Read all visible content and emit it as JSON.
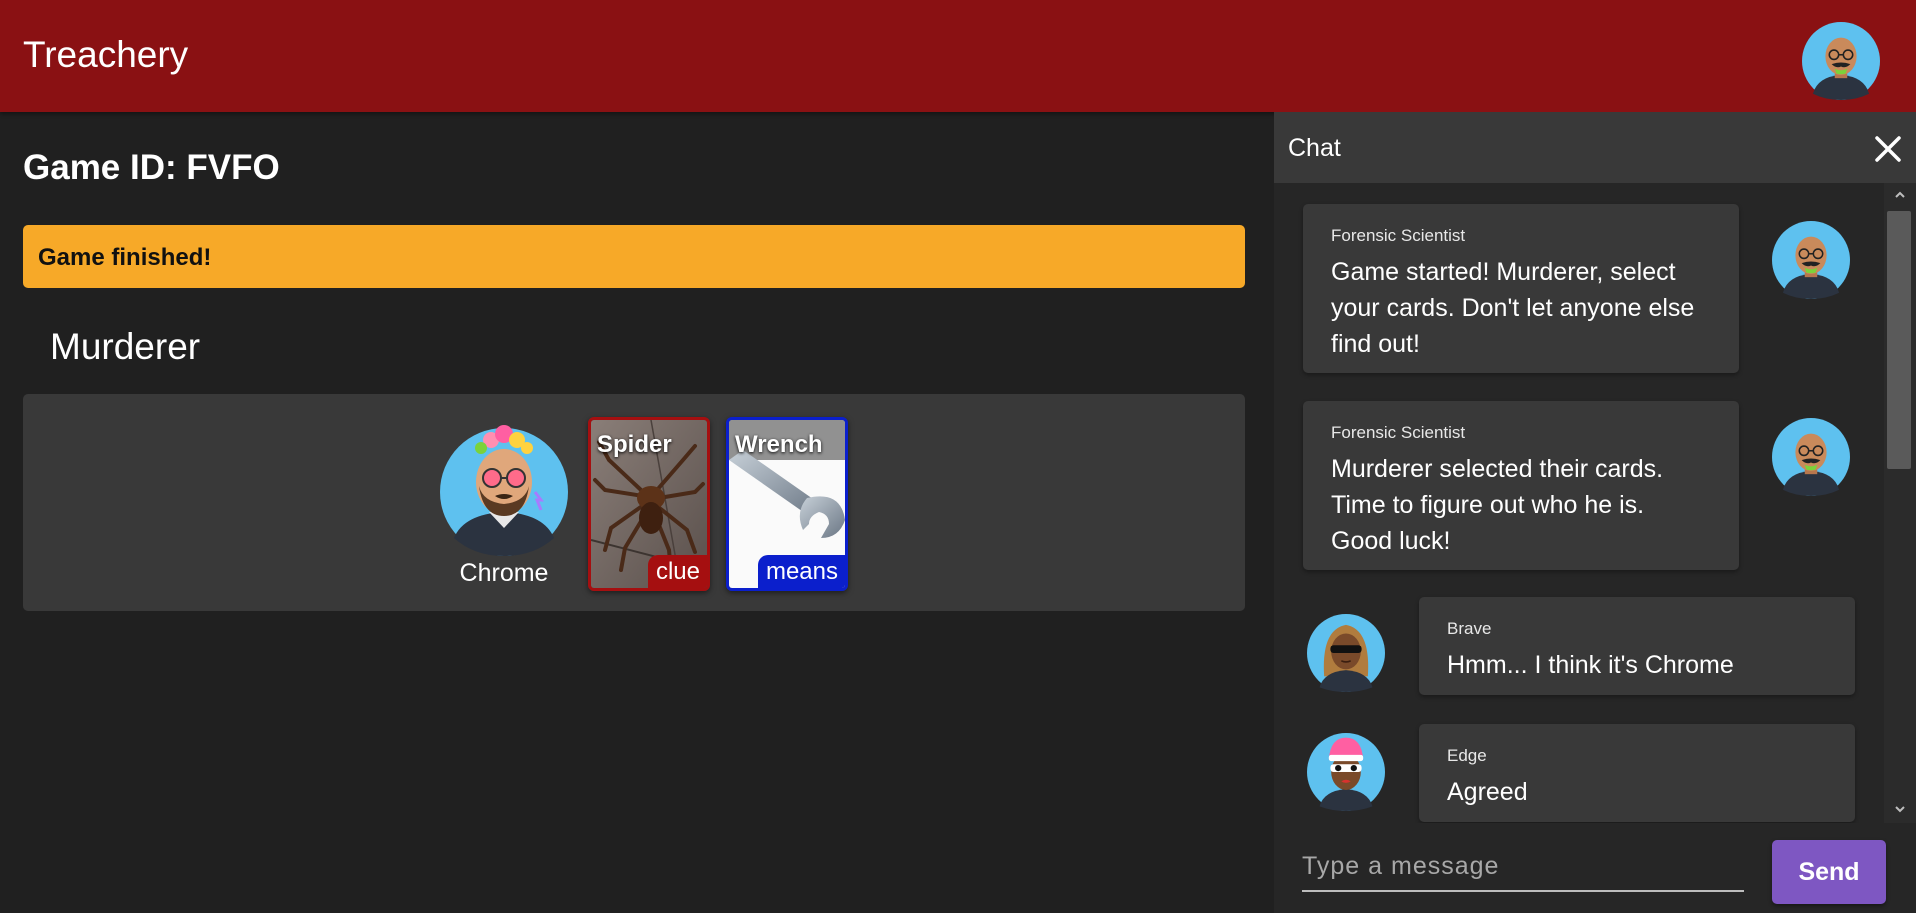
{
  "app": {
    "title": "Treachery"
  },
  "game": {
    "id_label": "Game ID: FVFO",
    "status": "Game finished!",
    "role_title": "Murderer",
    "player": {
      "name": "Chrome"
    },
    "cards": [
      {
        "name": "Spider",
        "type": "clue"
      },
      {
        "name": "Wrench",
        "type": "means"
      }
    ]
  },
  "chat": {
    "title": "Chat",
    "messages": [
      {
        "author": "Forensic Scientist",
        "lines": [
          "Game started! Murderer, select",
          "your cards. Don't let anyone else",
          "find out!"
        ]
      },
      {
        "author": "Forensic Scientist",
        "lines": [
          "Murderer selected their cards.",
          "Time to figure out who he is.",
          "Good luck!"
        ]
      },
      {
        "author": "Brave",
        "lines": [
          "Hmm... I think it's Chrome"
        ]
      },
      {
        "author": "Edge",
        "lines": [
          "Agreed"
        ]
      }
    ],
    "input_placeholder": "Type a message",
    "send_label": "Send"
  },
  "colors": {
    "appbar": "#8a1113",
    "status": "#f7a928",
    "clue": "#a50f10",
    "means": "#0b1fcc",
    "send": "#7e57c2"
  },
  "icons": [
    "user-avatar-icon",
    "close-icon",
    "chevron-up-icon",
    "chevron-down-icon"
  ]
}
